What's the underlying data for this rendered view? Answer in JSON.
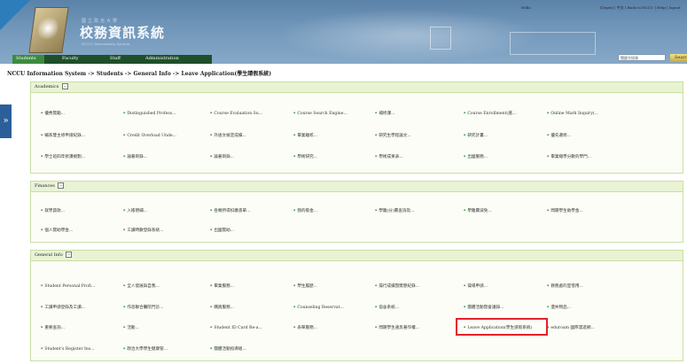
{
  "header": {
    "logo_sub": "國立政治大學",
    "logo_title": "校務資訊系統",
    "logo_en": "NCCU Information System",
    "hello": "Hello",
    "toplinks": "[Depts] | 中文 | Back to NCCU | Help | logout",
    "nav": [
      {
        "label": "Students"
      },
      {
        "label": "Faculty"
      },
      {
        "label": "Staff"
      },
      {
        "label": "Administration"
      }
    ],
    "search_placeholder": "關鍵字搜尋",
    "search_button": "Search"
  },
  "breadcrumb": "NCCU Information System -> Students -> General Info -> Leave Application(學生請假系統)",
  "expander": "»",
  "panels": [
    {
      "title": "Academics",
      "toggle": "−",
      "rows": [
        [
          "優秀獎勵...",
          "Distinguished Profess...",
          "Course Evaluation Su...",
          "Course Search Engine...",
          "補修課...",
          "Course Enrollment(選...",
          "Online Mark Inquiry(..."
        ],
        [
          "輔系雙主修申請紀錄...",
          "Credit Overload Unde...",
          "外語文檢定成績...",
          "畢業離校...",
          "研究生學程論文...",
          "研究計畫...",
          "優先選修..."
        ],
        [
          "學士班四年修課規劃...",
          "論著目錄...",
          "論著目錄...",
          "學術研究...",
          "學術成果表...",
          "出國服務...",
          "畢業總學分數的學門..."
        ]
      ]
    },
    {
      "title": "Finances",
      "toggle": "−",
      "rows": [
        [
          "就學貸款...",
          "入帳明細...",
          "各類所得扣繳憑單...",
          "我的帳金...",
          "學雜(分)費查詢及...",
          "學雜費減免...",
          "問題學生助學金..."
        ],
        [
          "個人獎助學金...",
          "工讀時數登錄系統...",
          "出國獎助..."
        ]
      ]
    },
    {
      "title": "General Info",
      "toggle": "−",
      "rows": [
        [
          "Student Personal Profi...",
          "全人發展與自我...",
          "畢業服務...",
          "學生履歷...",
          "操行成績暨獎懲紀錄...",
          "操場申請...",
          "教務處的室借用..."
        ],
        [
          "工讀申請登錄及工讀...",
          "作息聯合醫院門診...",
          "購買服務...",
          "Counseling Reservat...",
          "宿舍系統...",
          "團體活動暨會議錄...",
          "遺失物品..."
        ],
        [
          "重要查詢...",
          "活動...",
          "Student ID Card Re-a...",
          "表單服務...",
          "問題學生違反著作權...",
          "Leave Application(學生請假系統)",
          "eduroam 國際漫遊網..."
        ],
        [
          "Student's Register Ins...",
          "政治大學學生健康管...",
          "團體活動指導組..."
        ]
      ]
    }
  ]
}
